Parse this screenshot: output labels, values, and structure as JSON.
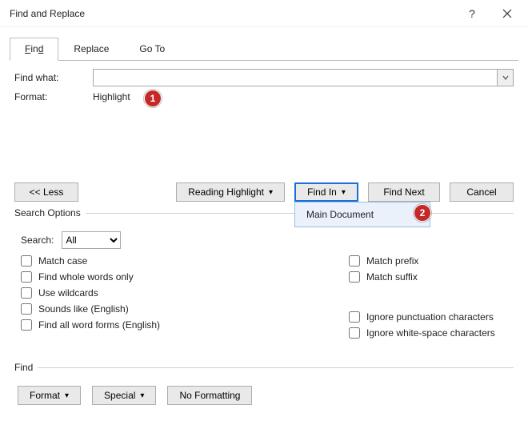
{
  "title": "Find and Replace",
  "tabs": {
    "find": "Find",
    "replace": "Replace",
    "goto": "Go To"
  },
  "labels": {
    "find_what": "Find what:",
    "format": "Format:",
    "format_value": "Highlight"
  },
  "buttons": {
    "less": "<< Less",
    "reading_highlight": "Reading Highlight",
    "find_in": "Find In",
    "find_next": "Find Next",
    "cancel": "Cancel",
    "format_btn": "Format",
    "special_btn": "Special",
    "no_formatting": "No Formatting"
  },
  "dropdown": {
    "main_document": "Main Document"
  },
  "search_options_legend": "Search Options",
  "search_label": "Search:",
  "search_value": "All",
  "checks_left": {
    "match_case": "Match case",
    "whole_words": "Find whole words only",
    "wildcards": "Use wildcards",
    "sounds_like": "Sounds like (English)",
    "word_forms": "Find all word forms (English)"
  },
  "checks_right": {
    "match_prefix": "Match prefix",
    "match_suffix": "Match suffix",
    "ignore_punct": "Ignore punctuation characters",
    "ignore_ws": "Ignore white-space characters"
  },
  "find_legend": "Find",
  "badges": {
    "b1": "1",
    "b2": "2"
  }
}
